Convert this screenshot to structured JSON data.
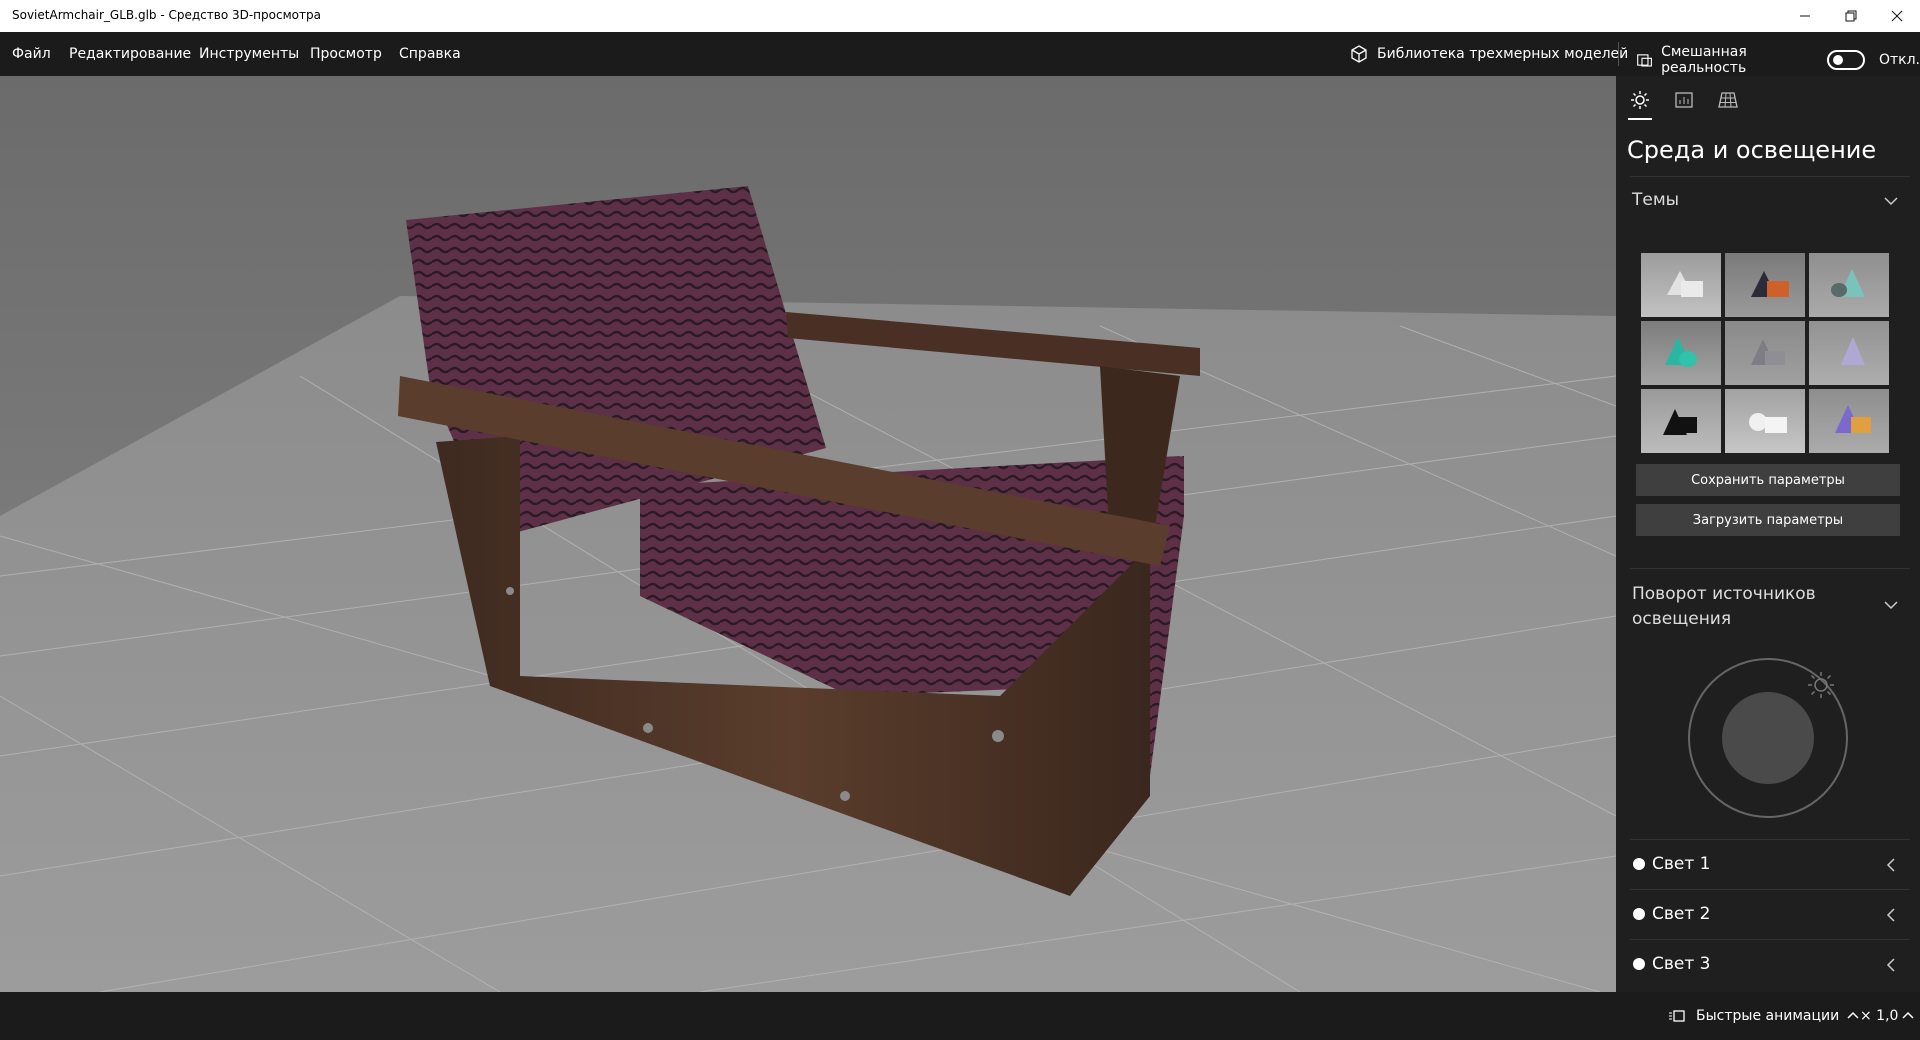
{
  "window": {
    "title": "SovietArmchair_GLB.glb - Средство 3D-просмотра"
  },
  "menu": [
    {
      "label": "Файл"
    },
    {
      "label": "Редактирование"
    },
    {
      "label": "Инструменты"
    },
    {
      "label": "Просмотр"
    },
    {
      "label": "Справка"
    }
  ],
  "toolbar": {
    "library_label": "Библиотека трехмерных моделей",
    "mixed_reality_label": "Смешанная реальность",
    "mixed_reality_state": "Откл."
  },
  "panel": {
    "heading": "Среда и освещение",
    "themes_title": "Темы",
    "save_button": "Сохранить параметры",
    "load_button": "Загрузить параметры",
    "rotation_title_line1": "Поворот источников",
    "rotation_title_line2": "освещения",
    "lights": [
      {
        "label": "Свет 1"
      },
      {
        "label": "Свет 2"
      },
      {
        "label": "Свет 3"
      }
    ]
  },
  "bottom": {
    "animations_label": "Быстрые анимации",
    "speed": "× 1,0"
  },
  "colors": {
    "accent": "#ffffff",
    "panel_bg": "#1f1f1f",
    "fabric": "#5a2f45",
    "wood": "#4a3326"
  }
}
